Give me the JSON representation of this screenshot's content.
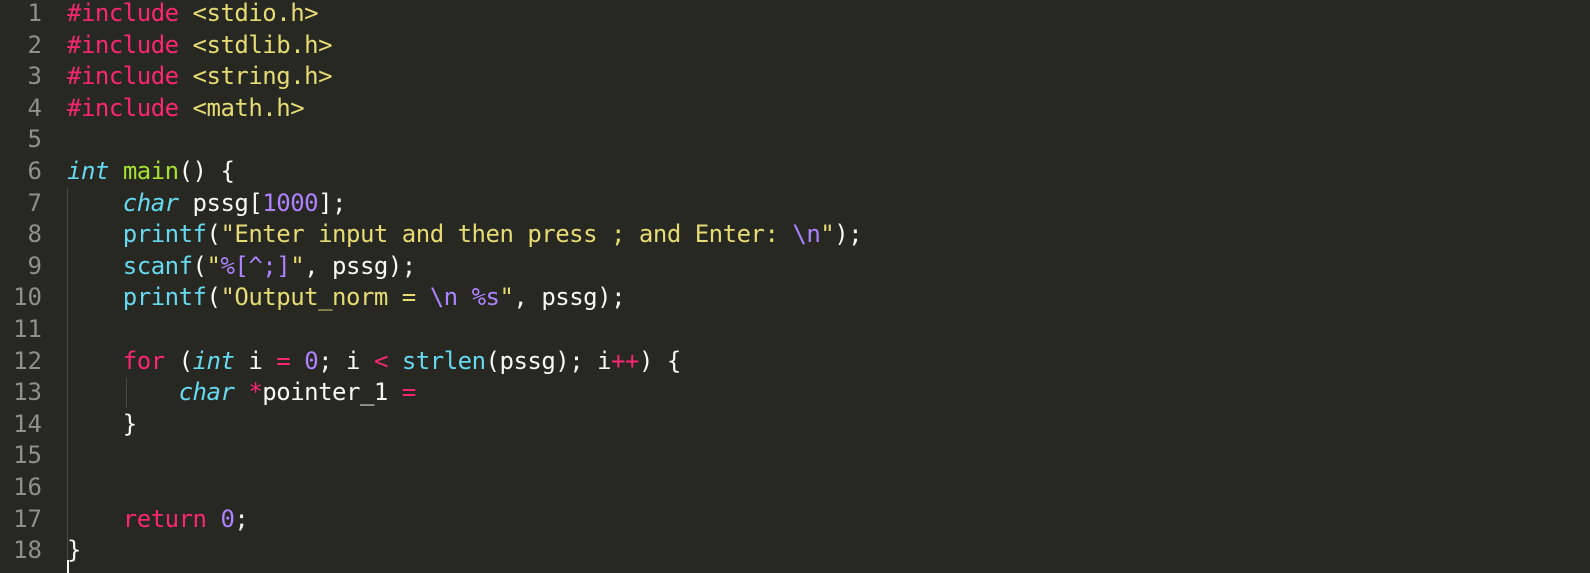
{
  "editor": {
    "theme": {
      "background": "#272822",
      "gutter_color": "#8f908a",
      "preprocessor": "#f92672",
      "header_string": "#e6db74",
      "type_keyword": "#66d9ef",
      "function_name": "#a6e22e",
      "number": "#ae81ff",
      "keyword": "#f92672",
      "plain": "#f8f8f2"
    },
    "lines": [
      {
        "num": "1",
        "tokens": [
          {
            "t": "#include",
            "c": "pp"
          },
          {
            "t": " ",
            "c": "plain"
          },
          {
            "t": "<stdio.h>",
            "c": "hdr"
          }
        ]
      },
      {
        "num": "2",
        "tokens": [
          {
            "t": "#include",
            "c": "pp"
          },
          {
            "t": " ",
            "c": "plain"
          },
          {
            "t": "<stdlib.h>",
            "c": "hdr"
          }
        ]
      },
      {
        "num": "3",
        "tokens": [
          {
            "t": "#include",
            "c": "pp"
          },
          {
            "t": " ",
            "c": "plain"
          },
          {
            "t": "<string.h>",
            "c": "hdr"
          }
        ]
      },
      {
        "num": "4",
        "tokens": [
          {
            "t": "#include",
            "c": "pp"
          },
          {
            "t": " ",
            "c": "plain"
          },
          {
            "t": "<math.h>",
            "c": "hdr"
          }
        ]
      },
      {
        "num": "5",
        "tokens": []
      },
      {
        "num": "6",
        "tokens": [
          {
            "t": "int",
            "c": "type"
          },
          {
            "t": " ",
            "c": "plain"
          },
          {
            "t": "main",
            "c": "fn"
          },
          {
            "t": "() {",
            "c": "plain"
          }
        ]
      },
      {
        "num": "7",
        "tokens": [
          {
            "t": "    ",
            "c": "plain"
          },
          {
            "t": "char",
            "c": "type"
          },
          {
            "t": " pssg[",
            "c": "plain"
          },
          {
            "t": "1000",
            "c": "num"
          },
          {
            "t": "];",
            "c": "plain"
          }
        ]
      },
      {
        "num": "8",
        "tokens": [
          {
            "t": "    ",
            "c": "plain"
          },
          {
            "t": "printf",
            "c": "call"
          },
          {
            "t": "(",
            "c": "plain"
          },
          {
            "t": "\"Enter input and then press ; and Enter: ",
            "c": "str"
          },
          {
            "t": "\\n",
            "c": "esc"
          },
          {
            "t": "\"",
            "c": "str"
          },
          {
            "t": ");",
            "c": "plain"
          }
        ]
      },
      {
        "num": "9",
        "tokens": [
          {
            "t": "    ",
            "c": "plain"
          },
          {
            "t": "scanf",
            "c": "call"
          },
          {
            "t": "(",
            "c": "plain"
          },
          {
            "t": "\"",
            "c": "str"
          },
          {
            "t": "%[^;]",
            "c": "esc"
          },
          {
            "t": "\"",
            "c": "str"
          },
          {
            "t": ", pssg);",
            "c": "plain"
          }
        ]
      },
      {
        "num": "10",
        "tokens": [
          {
            "t": "    ",
            "c": "plain"
          },
          {
            "t": "printf",
            "c": "call"
          },
          {
            "t": "(",
            "c": "plain"
          },
          {
            "t": "\"Output_norm = ",
            "c": "str"
          },
          {
            "t": "\\n",
            "c": "esc"
          },
          {
            "t": " ",
            "c": "str"
          },
          {
            "t": "%s",
            "c": "esc"
          },
          {
            "t": "\"",
            "c": "str"
          },
          {
            "t": ", pssg);",
            "c": "plain"
          }
        ]
      },
      {
        "num": "11",
        "tokens": []
      },
      {
        "num": "12",
        "tokens": [
          {
            "t": "    ",
            "c": "plain"
          },
          {
            "t": "for",
            "c": "kw"
          },
          {
            "t": " (",
            "c": "plain"
          },
          {
            "t": "int",
            "c": "type"
          },
          {
            "t": " i ",
            "c": "plain"
          },
          {
            "t": "=",
            "c": "op"
          },
          {
            "t": " ",
            "c": "plain"
          },
          {
            "t": "0",
            "c": "num"
          },
          {
            "t": "; i ",
            "c": "plain"
          },
          {
            "t": "<",
            "c": "op"
          },
          {
            "t": " ",
            "c": "plain"
          },
          {
            "t": "strlen",
            "c": "call"
          },
          {
            "t": "(pssg); i",
            "c": "plain"
          },
          {
            "t": "++",
            "c": "op"
          },
          {
            "t": ") {",
            "c": "plain"
          }
        ]
      },
      {
        "num": "13",
        "tokens": [
          {
            "t": "        ",
            "c": "plain"
          },
          {
            "t": "char",
            "c": "type"
          },
          {
            "t": " ",
            "c": "plain"
          },
          {
            "t": "*",
            "c": "op"
          },
          {
            "t": "pointer_1 ",
            "c": "plain"
          },
          {
            "t": "=",
            "c": "op"
          }
        ]
      },
      {
        "num": "14",
        "tokens": [
          {
            "t": "    }",
            "c": "plain"
          }
        ]
      },
      {
        "num": "15",
        "tokens": []
      },
      {
        "num": "16",
        "tokens": []
      },
      {
        "num": "17",
        "tokens": [
          {
            "t": "    ",
            "c": "plain"
          },
          {
            "t": "return",
            "c": "kw"
          },
          {
            "t": " ",
            "c": "plain"
          },
          {
            "t": "0",
            "c": "num"
          },
          {
            "t": ";",
            "c": "plain"
          }
        ]
      },
      {
        "num": "18",
        "tokens": [
          {
            "t": "}",
            "c": "plain"
          }
        ]
      }
    ]
  }
}
